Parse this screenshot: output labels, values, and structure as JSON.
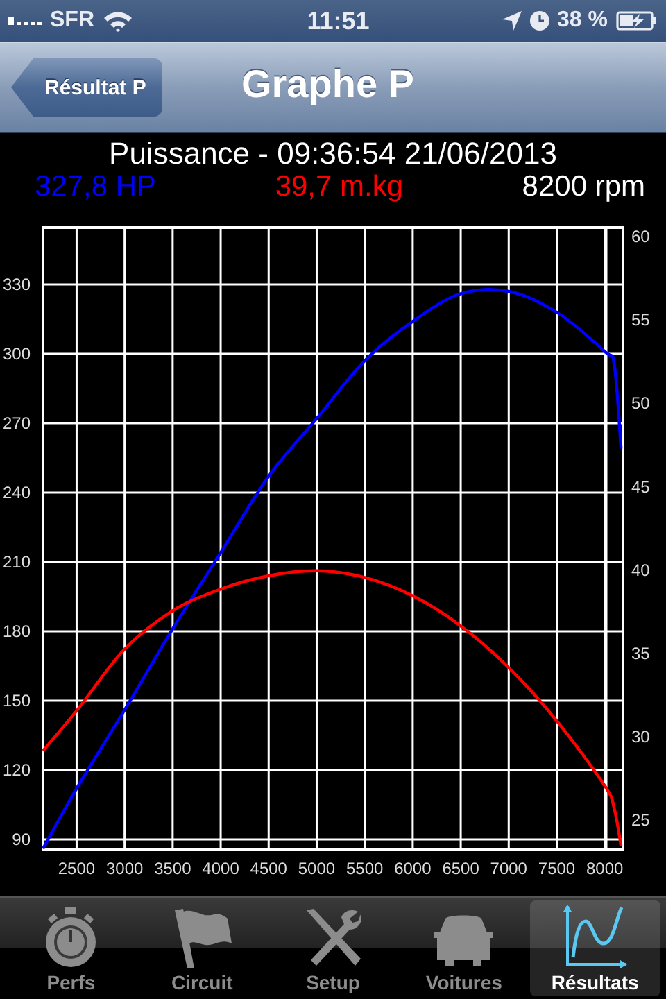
{
  "status_bar": {
    "carrier": "SFR",
    "time": "11:51",
    "battery": "38 %"
  },
  "nav_bar": {
    "back_button": "Résultat P",
    "title": "Graphe P"
  },
  "graph": {
    "title": "Puissance - 09:36:54 21/06/2013",
    "readings": [
      {
        "text": "327,8 HP",
        "color": "#0000ff"
      },
      {
        "text": "39,7 m.kg",
        "color": "#ff0000"
      },
      {
        "text": "8200 rpm",
        "color": "#ffffff"
      }
    ],
    "chart_data": {
      "type": "line",
      "x": [
        2150,
        2500,
        3000,
        3500,
        4000,
        4500,
        5000,
        5500,
        6000,
        6500,
        7000,
        7500,
        8000,
        8100,
        8170
      ],
      "series": [
        {
          "color": "#0000ff",
          "values": [
            86,
            112,
            146,
            181,
            214,
            247,
            272,
            297,
            314,
            326,
            327,
            318,
            301,
            295,
            259
          ]
        },
        {
          "color": "#ff0000",
          "axis": "y2",
          "values": [
            28.9,
            31.3,
            35,
            37.3,
            38.6,
            39.4,
            39.7,
            39.3,
            38.2,
            36.4,
            33.9,
            30.7,
            26.8,
            25.4,
            23.2
          ]
        }
      ],
      "grid": true,
      "xlim": [
        2150,
        8190
      ],
      "ylim": [
        85.8,
        354.6
      ],
      "y2lim": [
        23,
        60.3
      ],
      "xticks": [
        2500,
        3000,
        3500,
        4000,
        4500,
        5000,
        5500,
        6000,
        6500,
        7000,
        7500,
        8000
      ],
      "yticks": [
        90,
        120,
        150,
        180,
        210,
        240,
        270,
        300,
        330
      ],
      "y2ticks": [
        25,
        30,
        35,
        40,
        45,
        50,
        55,
        60
      ]
    }
  },
  "tabs": [
    {
      "label": "Perfs",
      "kind": "stopwatch",
      "selected": false
    },
    {
      "label": "Circuit",
      "kind": "flag",
      "selected": false
    },
    {
      "label": "Setup",
      "kind": "tools",
      "selected": false
    },
    {
      "label": "Voitures",
      "kind": "car",
      "selected": false
    },
    {
      "label": "Résultats",
      "kind": "graph",
      "selected": true
    }
  ]
}
